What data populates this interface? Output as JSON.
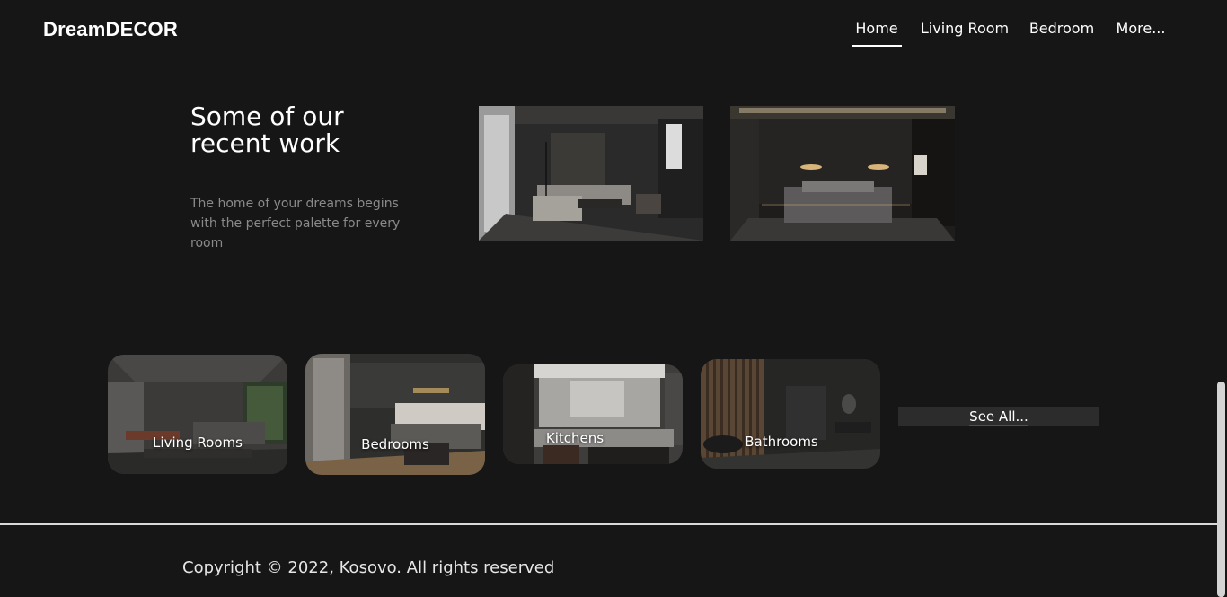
{
  "header": {
    "logo": "DreamDECOR",
    "nav": [
      {
        "label": "Home",
        "active": true
      },
      {
        "label": "Living Room",
        "active": false
      },
      {
        "label": "Bedroom",
        "active": false
      },
      {
        "label": "More...",
        "active": false
      }
    ]
  },
  "recent": {
    "title": "Some of our recent work",
    "description": "The home of your dreams begins with the perfect palette for every room"
  },
  "categories": [
    {
      "label": "Living Rooms"
    },
    {
      "label": "Bedrooms"
    },
    {
      "label": "Kitchens"
    },
    {
      "label": "Bathrooms"
    }
  ],
  "see_all": "See All...",
  "footer": {
    "copyright": "Copyright © 2022, Kosovo. All rights reserved"
  }
}
